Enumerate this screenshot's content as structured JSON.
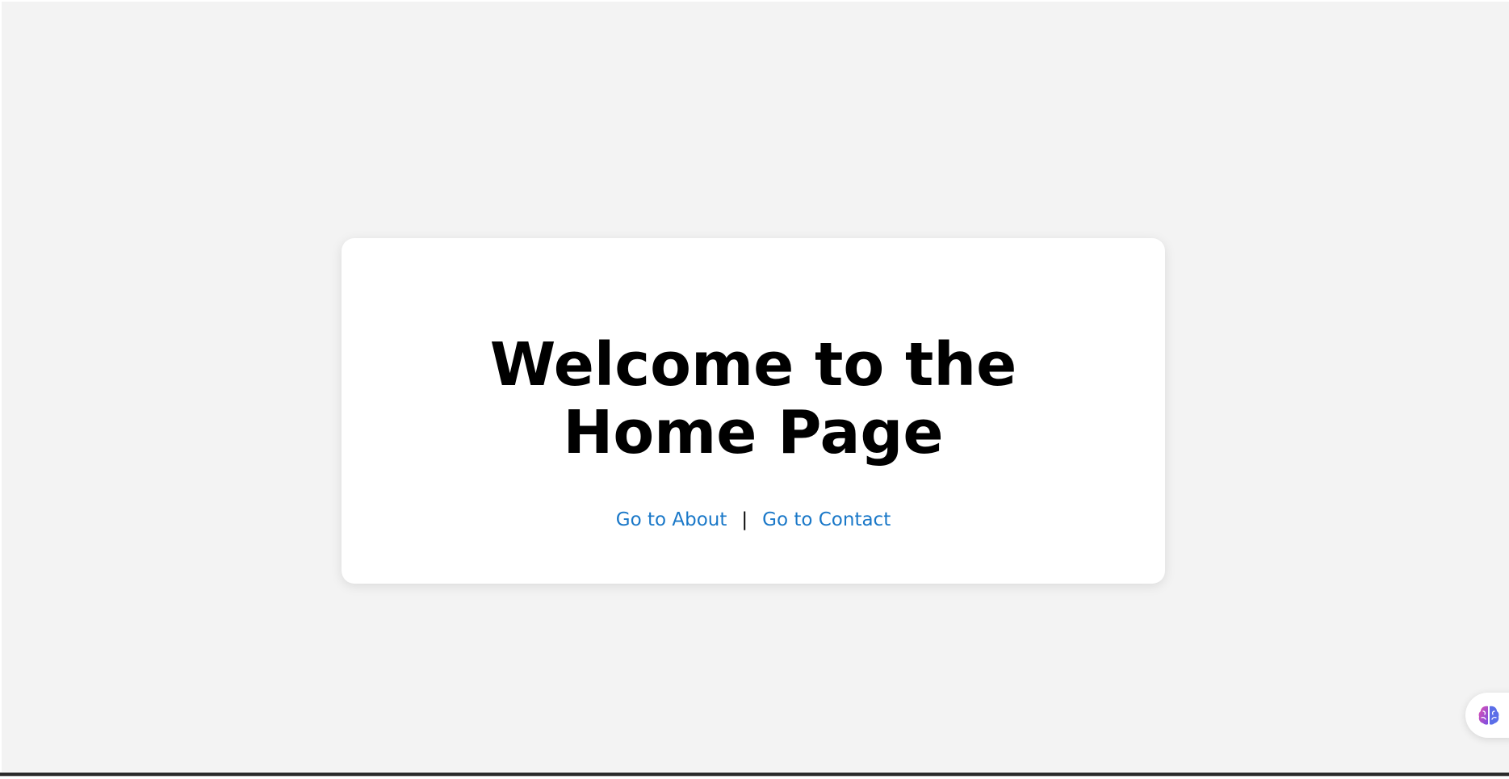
{
  "main": {
    "title": "Welcome to the Home Page",
    "links": {
      "about_label": "Go to About",
      "separator": "|",
      "contact_label": "Go to Contact"
    }
  },
  "floating_button": {
    "icon": "brain-icon"
  },
  "colors": {
    "page_background": "#f3f3f3",
    "card_background": "#ffffff",
    "link": "#1a78c8",
    "title": "#000000"
  }
}
